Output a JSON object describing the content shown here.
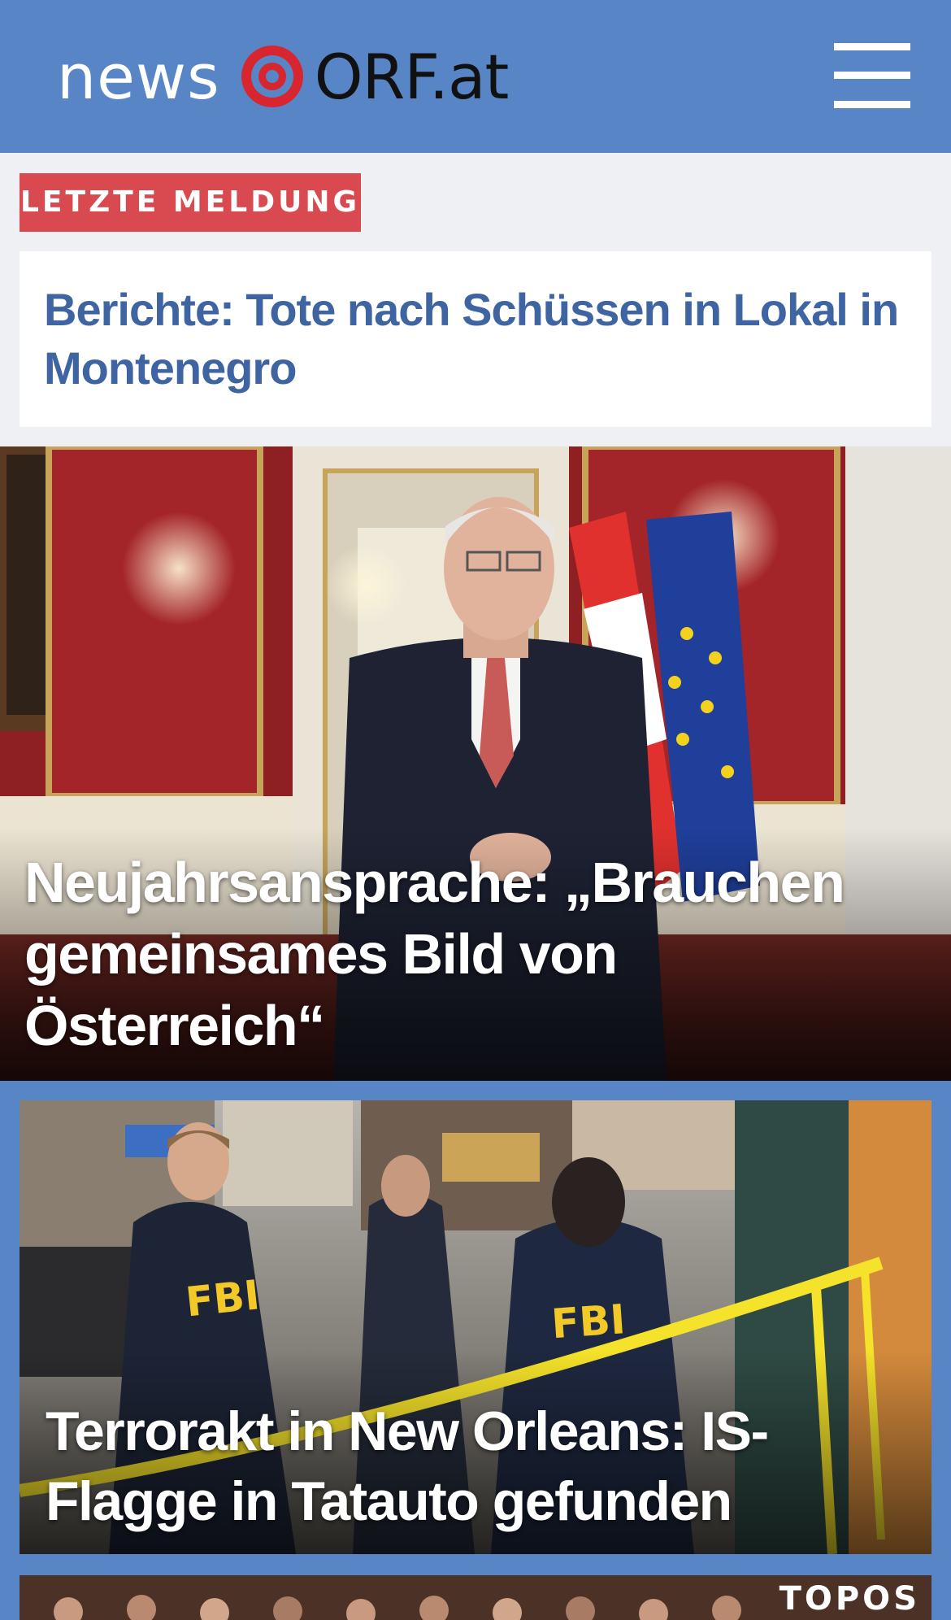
{
  "header": {
    "logo_text_left": "news",
    "logo_text_right": "ORF.at",
    "menu_icon": "hamburger-menu-icon",
    "brand_color": "#5785c6",
    "logo_accent": "#d7262f"
  },
  "breaking": {
    "badge": "LETZTE MELDUNG",
    "title": "Berichte: Tote nach Schüssen in Lokal in Montenegro",
    "badge_color": "#d94a50",
    "title_color": "#3f64a2"
  },
  "stories": [
    {
      "title": "Neujahrsansprache: „Brauchen gemeinsames Bild von Österreich“",
      "image": "president-in-palace-photo"
    },
    {
      "title": "Terrorakt in New Orleans: IS-Flagge in Tatauto gefunden",
      "image": "fbi-agents-crime-scene-photo"
    },
    {
      "label": "TOPOS",
      "image": "audience-photo"
    }
  ]
}
